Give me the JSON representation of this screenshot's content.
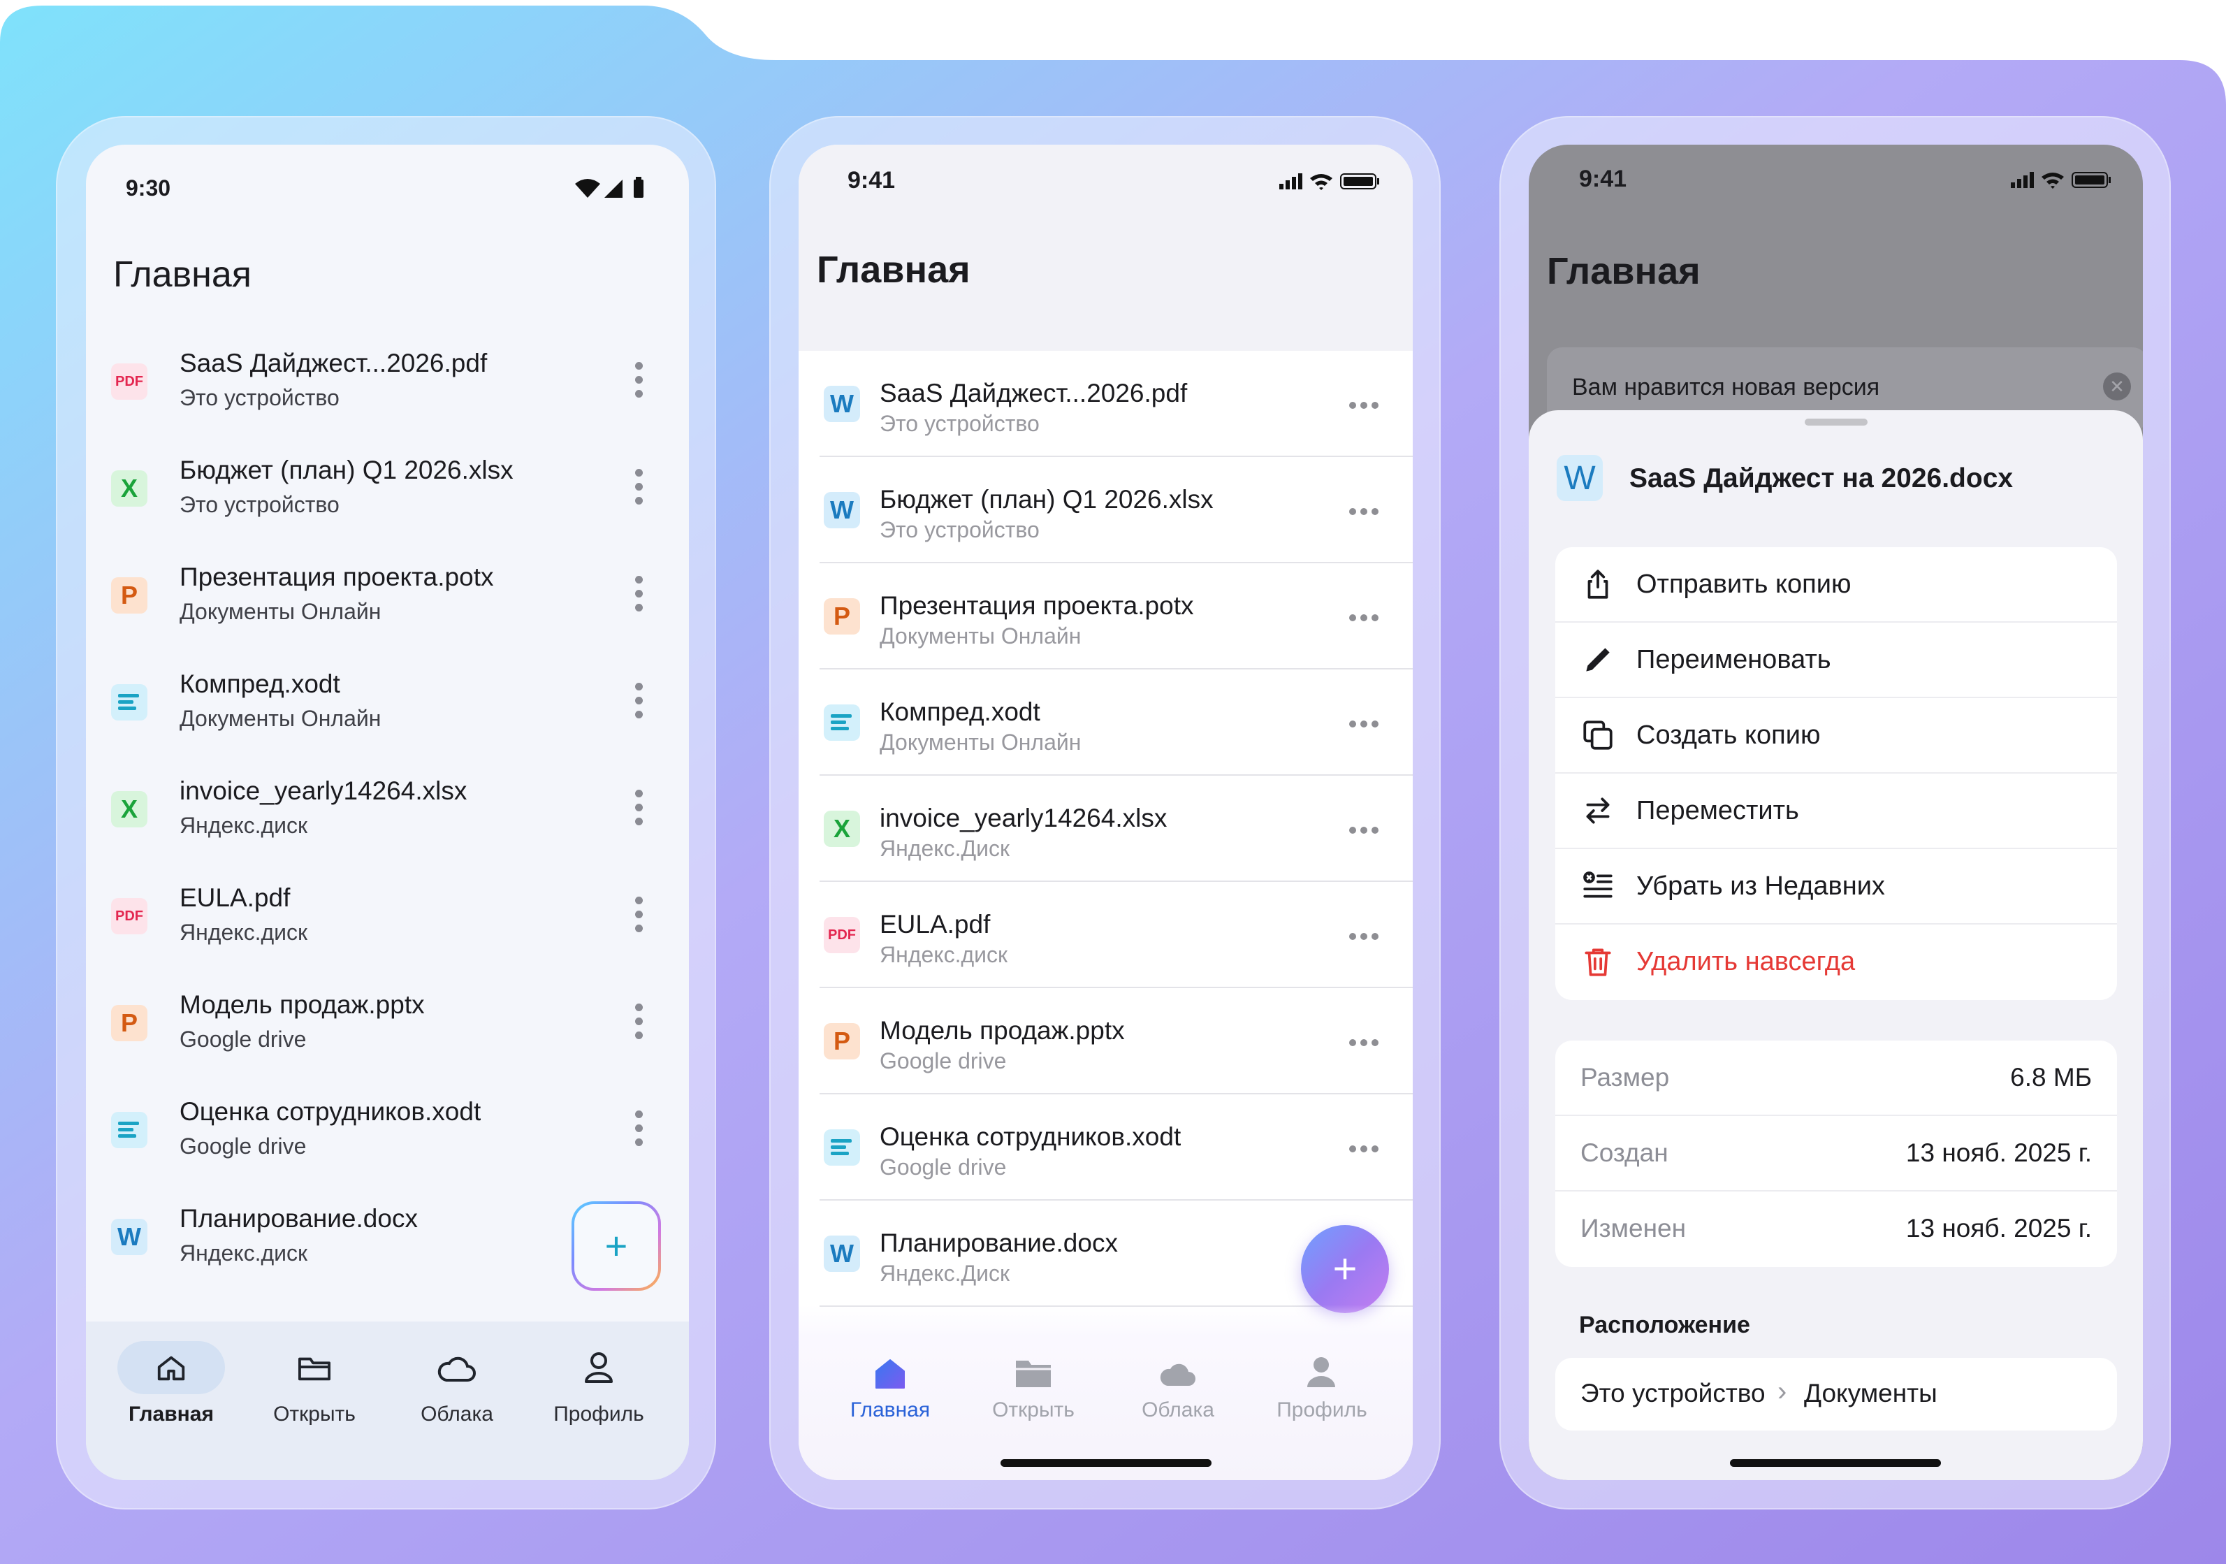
{
  "android": {
    "status_time": "9:30",
    "title": "Главная",
    "files": [
      {
        "name": "SaaS Дайджест...2026.pdf",
        "source": "Это устройство",
        "icon": "pdf",
        "glyph": "PDF"
      },
      {
        "name": "Бюджет (план) Q1 2026.xlsx",
        "source": "Это устройство",
        "icon": "x",
        "glyph": "X"
      },
      {
        "name": "Презентация проекта.potx",
        "source": "Документы Онлайн",
        "icon": "p",
        "glyph": "P"
      },
      {
        "name": "Компред.xodt",
        "source": "Документы Онлайн",
        "icon": "doc",
        "glyph": ""
      },
      {
        "name": "invoice_yearly14264.xlsx",
        "source": "Яндекс.диск",
        "icon": "x",
        "glyph": "X"
      },
      {
        "name": "EULA.pdf",
        "source": "Яндекс.диск",
        "icon": "pdf",
        "glyph": "PDF"
      },
      {
        "name": "Модель продаж.pptx",
        "source": "Google drive",
        "icon": "p",
        "glyph": "P"
      },
      {
        "name": "Оценка сотрудников.xodt",
        "source": "Google drive",
        "icon": "doc",
        "glyph": ""
      },
      {
        "name": "Планирование.docx",
        "source": "Яндекс.диск",
        "icon": "w",
        "glyph": "W"
      }
    ],
    "fab": "+",
    "nav": [
      "Главная",
      "Открыть",
      "Облака",
      "Профиль"
    ]
  },
  "ios": {
    "status_time": "9:41",
    "title": "Главная",
    "files": [
      {
        "name": "SaaS Дайджест...2026.pdf",
        "source": "Это устройство",
        "icon": "w",
        "glyph": "W"
      },
      {
        "name": "Бюджет (план) Q1 2026.xlsx",
        "source": "Это устройство",
        "icon": "w",
        "glyph": "W"
      },
      {
        "name": "Презентация проекта.potx",
        "source": "Документы Онлайн",
        "icon": "p",
        "glyph": "P"
      },
      {
        "name": "Компред.xodt",
        "source": "Документы Онлайн",
        "icon": "doc",
        "glyph": ""
      },
      {
        "name": "invoice_yearly14264.xlsx",
        "source": "Яндекс.Диск",
        "icon": "x",
        "glyph": "X"
      },
      {
        "name": "EULA.pdf",
        "source": "Яндекс.диск",
        "icon": "pdf",
        "glyph": "PDF"
      },
      {
        "name": "Модель продаж.pptx",
        "source": "Google drive",
        "icon": "p",
        "glyph": "P"
      },
      {
        "name": "Оценка сотрудников.xodt",
        "source": "Google drive",
        "icon": "doc",
        "glyph": ""
      },
      {
        "name": "Планирование.docx",
        "source": "Яндекс.Диск",
        "icon": "w",
        "glyph": "W"
      }
    ],
    "fab": "+",
    "nav": [
      "Главная",
      "Открыть",
      "Облака",
      "Профиль"
    ]
  },
  "sheet": {
    "status_time": "9:41",
    "title": "Главная",
    "banner": "Вам нравится новая версия",
    "file_glyph": "W",
    "file_name": "SaaS Дайджест на 2026.docx",
    "actions": [
      {
        "label": "Отправить копию",
        "icon": "share-icon"
      },
      {
        "label": "Переименовать",
        "icon": "pencil-icon"
      },
      {
        "label": "Создать копию",
        "icon": "copy-icon"
      },
      {
        "label": "Переместить",
        "icon": "move-icon"
      },
      {
        "label": "Убрать из Недавних",
        "icon": "remove-list-icon"
      },
      {
        "label": "Удалить навсегда",
        "icon": "trash-icon",
        "destructive": true
      }
    ],
    "info": [
      {
        "key": "Размер",
        "value": "6.8 МБ"
      },
      {
        "key": "Создан",
        "value": "13 нояб. 2025 г."
      },
      {
        "key": "Изменен",
        "value": "13 нояб. 2025 г."
      }
    ],
    "location_title": "Расположение",
    "location": [
      "Это устройство",
      "Документы"
    ],
    "location_sep": "›"
  },
  "colors": {
    "accent_blue": "#2a62d8",
    "destructive": "#e53935",
    "fab_ios": "#8f7cf5"
  }
}
